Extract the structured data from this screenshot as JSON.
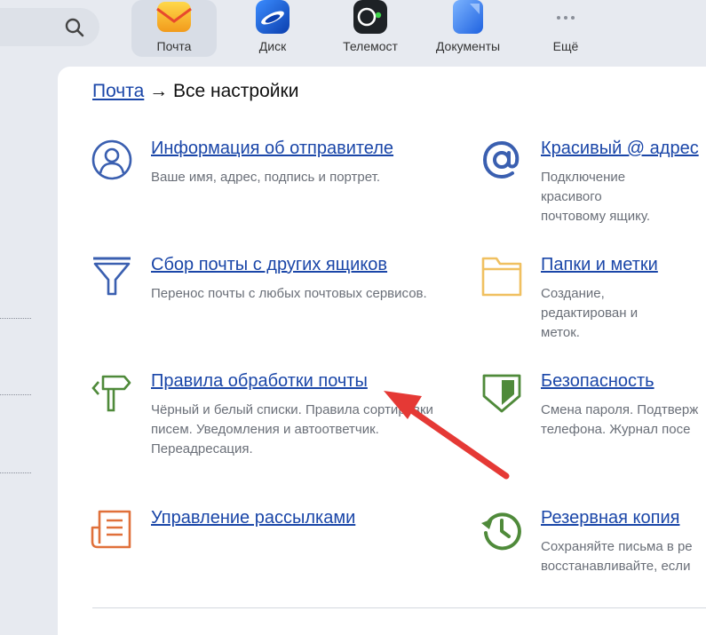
{
  "apps": [
    {
      "label": "Почта",
      "icon": "mail-envelope-icon",
      "active": true
    },
    {
      "label": "Диск",
      "icon": "disk-icon"
    },
    {
      "label": "Телемост",
      "icon": "telemost-camera-icon"
    },
    {
      "label": "Документы",
      "icon": "documents-icon"
    },
    {
      "label": "Ещё",
      "icon": "more-dots-icon"
    }
  ],
  "search": {
    "icon": "search-icon"
  },
  "breadcrumb": {
    "link": "Почта",
    "separator": " → ",
    "current": "Все настройки"
  },
  "sections": [
    {
      "title": "Информация об отправителе",
      "desc": "Ваше имя, адрес, подпись и портрет.",
      "icon": "user-profile-icon"
    },
    {
      "title": "Красивый @ адрес",
      "desc": "Подключение красивого почтовому ящику.",
      "icon": "at-sign-icon"
    },
    {
      "title": "Сбор почты с других ящиков",
      "desc": "Перенос почты с любых почтовых сервисов.",
      "icon": "funnel-icon"
    },
    {
      "title": "Папки и метки",
      "desc": "Создание, редактирован и меток.",
      "icon": "folder-icon"
    },
    {
      "title": "Правила обработки почты",
      "desc": "Чёрный и белый списки. Правила сортировки писем. Уведомления и автоответчик. Переадресация.",
      "icon": "signpost-icon"
    },
    {
      "title": "Безопасность",
      "desc": "Смена пароля. Подтверж телефона. Журнал посе",
      "icon": "shield-icon"
    },
    {
      "title": "Управление рассылками",
      "desc": "",
      "icon": "newsletter-icon"
    },
    {
      "title": "Резервная копия",
      "desc": "Сохраняйте письма в ре восстанавливайте, если",
      "icon": "backup-clock-icon"
    }
  ],
  "colors": {
    "link": "#1a46a8",
    "accent_red": "#e53935",
    "icon_blue": "#3a5fb0",
    "icon_green": "#4f8a3a",
    "icon_orange": "#e0703a",
    "icon_yellow": "#f0c060"
  },
  "annotation": {
    "type": "red-arrow",
    "target": "Правила обработки почты"
  }
}
